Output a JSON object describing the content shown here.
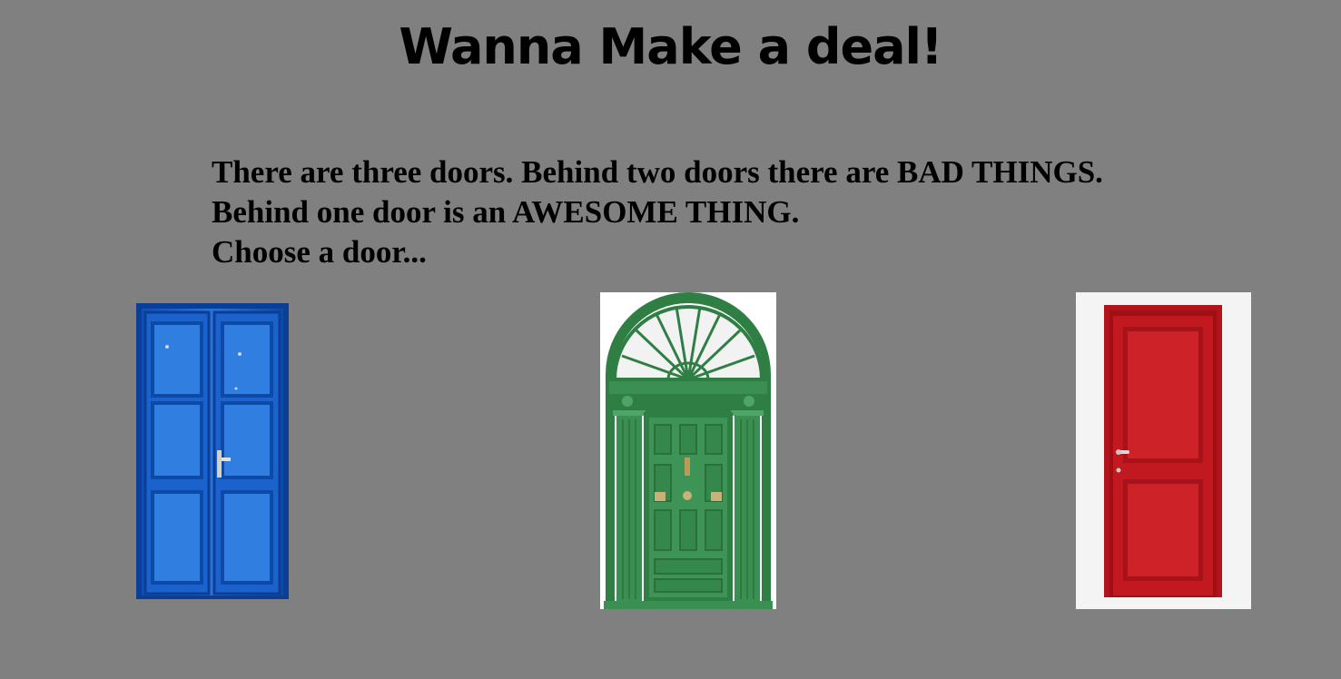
{
  "title": "Wanna Make a deal!",
  "intro": {
    "line1": "There are three doors. Behind two doors there are BAD THINGS.",
    "line2": "Behind one door is an AWESOME THING.",
    "line3": "Choose a door..."
  },
  "doors": [
    {
      "id": "blue",
      "color": "#1a5fc4",
      "style": "double-panel door"
    },
    {
      "id": "green",
      "color": "#3a8a4e",
      "style": "arched fanlight door"
    },
    {
      "id": "red",
      "color": "#b5161c",
      "style": "two-panel door"
    }
  ],
  "theme": {
    "background": "#808080",
    "text": "#000000"
  }
}
